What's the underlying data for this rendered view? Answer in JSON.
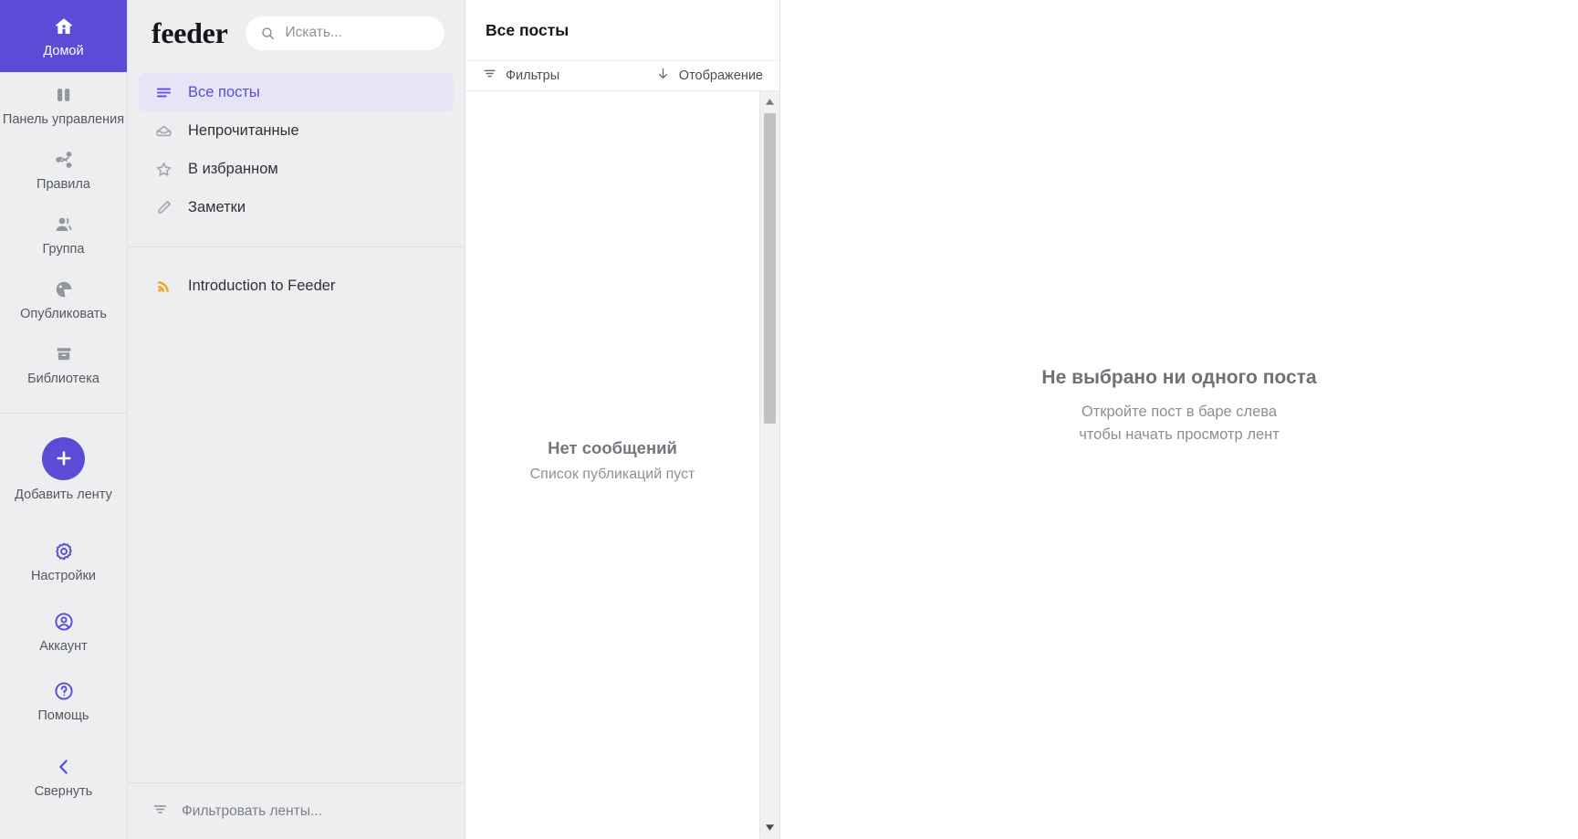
{
  "rail": {
    "items": [
      {
        "label": "Домой",
        "icon": "home-icon",
        "active": true
      },
      {
        "label": "Панель управления",
        "icon": "dashboard-icon",
        "active": false
      },
      {
        "label": "Правила",
        "icon": "share-icon",
        "active": false
      },
      {
        "label": "Группа",
        "icon": "group-icon",
        "active": false
      },
      {
        "label": "Опубликовать",
        "icon": "publish-icon",
        "active": false
      },
      {
        "label": "Библиотека",
        "icon": "library-icon",
        "active": false
      }
    ],
    "add_feed": {
      "label": "Добавить ленту",
      "icon": "plus-icon"
    },
    "bottom_items": [
      {
        "label": "Настройки",
        "icon": "gear-icon"
      },
      {
        "label": "Аккаунт",
        "icon": "account-circle-icon"
      },
      {
        "label": "Помощь",
        "icon": "help-circle-icon"
      },
      {
        "label": "Свернуть",
        "icon": "chevron-left-icon"
      }
    ]
  },
  "sidebar": {
    "brand": "feeder",
    "search": {
      "placeholder": "Искать...",
      "value": "",
      "icon": "search-icon"
    },
    "nav": [
      {
        "label": "Все посты",
        "icon": "list-icon",
        "active": true
      },
      {
        "label": "Непрочитанные",
        "icon": "inbox-icon",
        "active": false
      },
      {
        "label": "В избранном",
        "icon": "star-icon",
        "active": false
      },
      {
        "label": "Заметки",
        "icon": "pencil-icon",
        "active": false
      }
    ],
    "feeds": [
      {
        "label": "Introduction to Feeder",
        "icon": "rss-icon"
      }
    ],
    "filter_feeds": {
      "label": "Фильтровать ленты...",
      "icon": "filter-icon"
    }
  },
  "list_column": {
    "title": "Все посты",
    "toolbar": {
      "filters": {
        "label": "Фильтры",
        "icon": "filter-icon"
      },
      "display": {
        "label": "Отображение",
        "icon": "arrow-down-icon"
      }
    },
    "empty": {
      "title": "Нет сообщений",
      "subtitle": "Список публикаций пуст"
    },
    "scrollbar": {
      "up_icon": "caret-up-icon",
      "down_icon": "caret-down-icon"
    }
  },
  "reader": {
    "empty": {
      "title": "Не выбрано ни одного поста",
      "line1": "Откройте пост в баре слева",
      "line2": "чтобы начать просмотр лент"
    }
  },
  "colors": {
    "accent": "#5b4bd6",
    "accent_soft": "#e6e4f7",
    "rail_bg": "#eceef0",
    "rss_orange": "#f5a623",
    "muted_text": "#8d9197"
  }
}
